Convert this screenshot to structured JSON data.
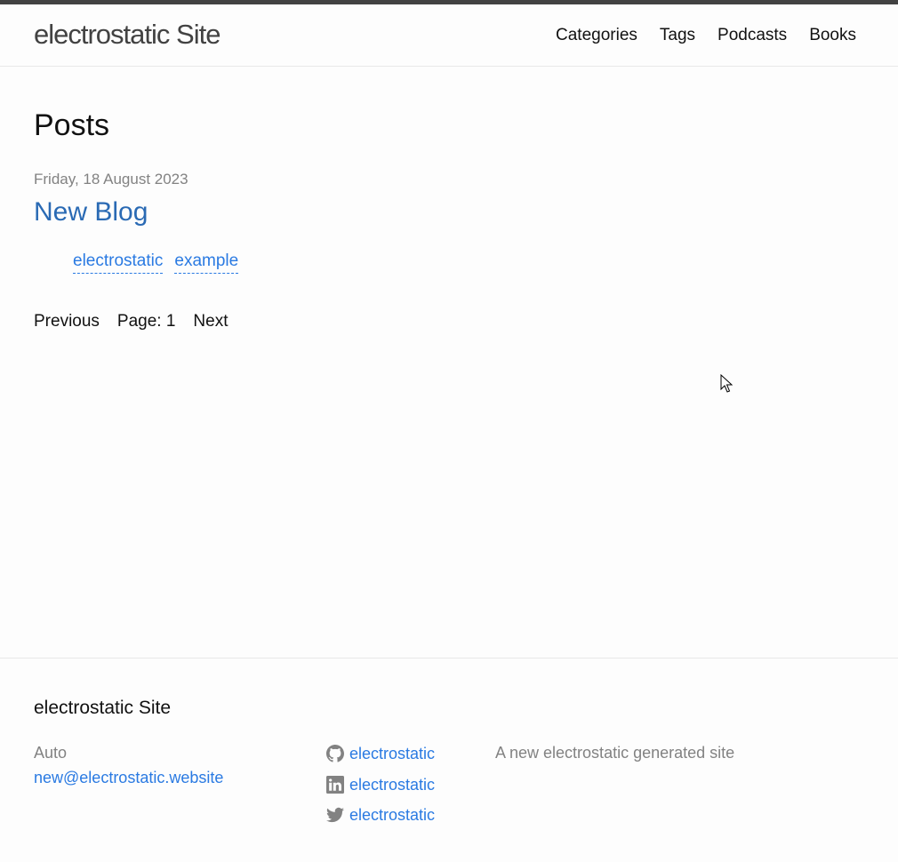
{
  "header": {
    "site_title": "electrostatic Site",
    "nav": [
      "Categories",
      "Tags",
      "Podcasts",
      "Books"
    ]
  },
  "main": {
    "heading": "Posts",
    "posts": [
      {
        "date": "Friday, 18 August 2023",
        "title": "New Blog",
        "tags": [
          "electrostatic",
          "example"
        ]
      }
    ],
    "pagination": {
      "previous_label": "Previous",
      "page_label": "Page: 1",
      "next_label": "Next"
    }
  },
  "footer": {
    "heading": "electrostatic Site",
    "author": "Auto",
    "email": "new@electrostatic.website",
    "social": [
      {
        "icon": "github-icon",
        "label": "electrostatic"
      },
      {
        "icon": "linkedin-icon",
        "label": "electrostatic"
      },
      {
        "icon": "twitter-icon",
        "label": "electrostatic"
      }
    ],
    "description": "A new electrostatic generated site"
  },
  "colors": {
    "link": "#2a7ae2",
    "post_title": "#2a6ab4",
    "meta": "#828282",
    "top_accent": "#424242"
  }
}
